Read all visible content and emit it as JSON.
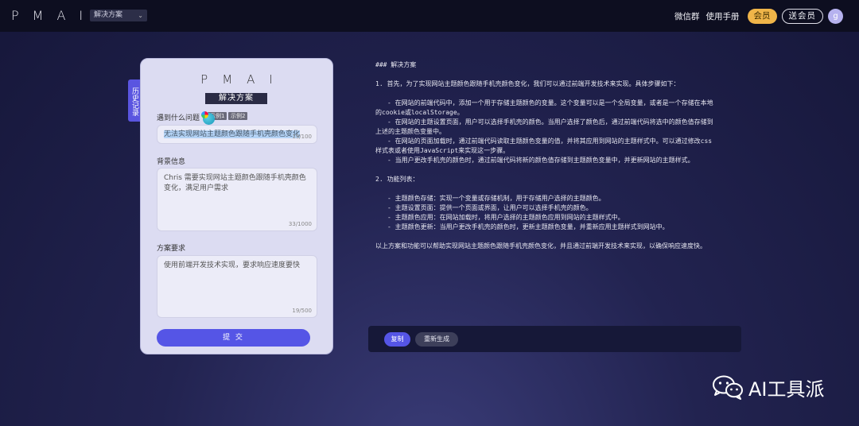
{
  "topbar": {
    "logo": "PMAI",
    "scheme_select": "解决方案",
    "wechat_group": "微信群",
    "manual": "使用手册",
    "vip": "会员",
    "gift_vip": "送会员",
    "avatar": "g"
  },
  "history_tab": "历史记录",
  "card": {
    "logo": "PMAI",
    "title": "解决方案",
    "problem_label": "遇到什么问题",
    "example1": "示例1",
    "example2": "示例2",
    "problem_value": "无法实现网站主题颜色跟随手机壳颜色变化",
    "problem_count": "19/100",
    "background_label": "背景信息",
    "background_value": "Chris 需要实现网站主题颜色跟随手机壳颜色变化，满足用户需求",
    "background_count": "33/1000",
    "requirement_label": "方案要求",
    "requirement_value": "使用前端开发技术实现，要求响应速度要快",
    "requirement_count": "19/500",
    "submit": "提 交"
  },
  "result": {
    "heading": "### 解决方案",
    "intro": "1. 首先，为了实现网站主题颜色跟随手机壳颜色变化，我们可以通过前端开发技术来实现。具体步骤如下：",
    "step1a": "- 在网站的前端代码中，添加一个用于存储主题颜色的变量。这个变量可以是一个全局变量，或者是一个存储在本地",
    "step1b": "的cookie或localStorage。",
    "step2a": "- 在网站的主题设置页面，用户可以选择手机壳的颜色。当用户选择了颜色后，通过前端代码将选中的颜色值存储到",
    "step2b": "上述的主题颜色变量中。",
    "step3a": "- 在网站的页面加载时，通过前端代码读取主题颜色变量的值，并将其应用到网站的主题样式中。可以通过修改css",
    "step3b": "样式表或者使用JavaScript来实现这一步骤。",
    "step4": "- 当用户更改手机壳的颜色时，通过前端代码将新的颜色值存储到主题颜色变量中，并更新网站的主题样式。",
    "features_title": "2. 功能列表：",
    "feature1": "- 主题颜色存储：实现一个变量或存储机制，用于存储用户选择的主题颜色。",
    "feature2": "- 主题设置页面：提供一个页面或界面，让用户可以选择手机壳的颜色。",
    "feature3": "- 主题颜色应用：在网站加载时，将用户选择的主题颜色应用到网站的主题样式中。",
    "feature4": "- 主题颜色更新：当用户更改手机壳的颜色时，更新主题颜色变量，并重新应用主题样式到网站中。",
    "conclusion": "以上方案和功能可以帮助实现网站主题颜色跟随手机壳颜色变化，并且通过前端开发技术来实现，以确保响应速度快。",
    "copy": "复制",
    "regenerate": "重新生成"
  },
  "watermark": "AI工具派"
}
